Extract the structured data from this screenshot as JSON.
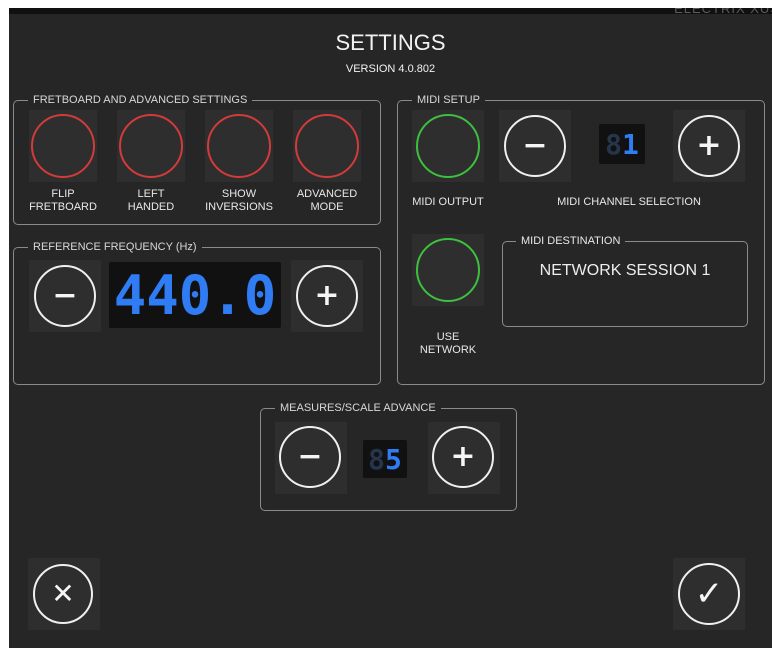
{
  "header": {
    "title": "SETTINGS",
    "version": "VERSION 4.0.802",
    "corner_text": "ELECTRIX XUS"
  },
  "fretboard": {
    "legend": "FRETBOARD AND ADVANCED SETTINGS",
    "toggles": [
      {
        "line1": "FLIP",
        "line2": "FRETBOARD",
        "state": "off"
      },
      {
        "line1": "LEFT",
        "line2": "HANDED",
        "state": "off"
      },
      {
        "line1": "SHOW",
        "line2": "INVERSIONS",
        "state": "off"
      },
      {
        "line1": "ADVANCED",
        "line2": "MODE",
        "state": "off"
      }
    ]
  },
  "reference": {
    "legend": "REFERENCE FREQUENCY (Hz)",
    "value": "440.0",
    "minus": "−",
    "plus": "+"
  },
  "midi": {
    "legend": "MIDI SETUP",
    "output_label": "MIDI OUTPUT",
    "output_state": "on",
    "channel_label": "MIDI CHANNEL SELECTION",
    "channel_value": "1",
    "minus": "−",
    "plus": "+",
    "network_line1": "USE",
    "network_line2": "NETWORK",
    "network_state": "on",
    "destination_legend": "MIDI DESTINATION",
    "destination_value": "NETWORK SESSION 1"
  },
  "measures": {
    "legend": "MEASURES/SCALE ADVANCE",
    "value": "5",
    "minus": "−",
    "plus": "+"
  },
  "footer": {
    "cancel_icon": "✕",
    "confirm_icon": "✓"
  },
  "colors": {
    "background": "#262626",
    "toggle_off": "#d33b3b",
    "toggle_on": "#3fbf3f",
    "lcd_digits": "#2f7cf5"
  }
}
